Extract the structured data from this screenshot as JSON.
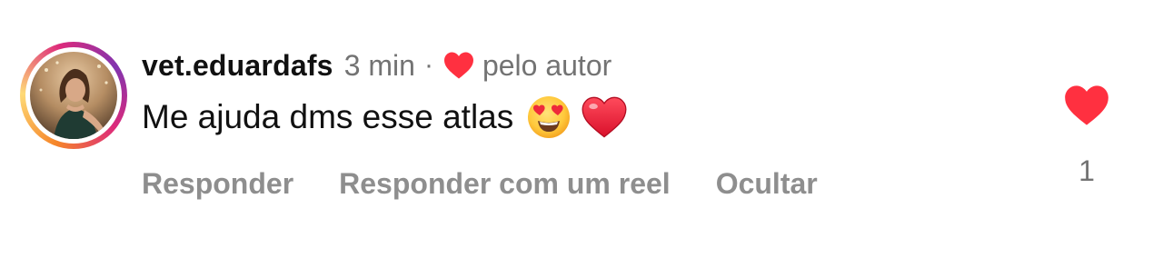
{
  "comment": {
    "username": "vet.eduardafs",
    "time": "3 min",
    "separator": "·",
    "liked_by_author_label": "pelo autor",
    "text": "Me ajuda dms esse atlas",
    "emojis": [
      "heart-eyes-emoji",
      "red-heart-emoji"
    ],
    "like_count": "1"
  },
  "actions": {
    "reply": "Responder",
    "reply_with_reel": "Responder com um reel",
    "hide": "Ocultar"
  },
  "colors": {
    "heart_red": "#ff3040",
    "muted_text": "#737373",
    "action_text": "#8e8e8e",
    "primary_text": "#111111"
  }
}
